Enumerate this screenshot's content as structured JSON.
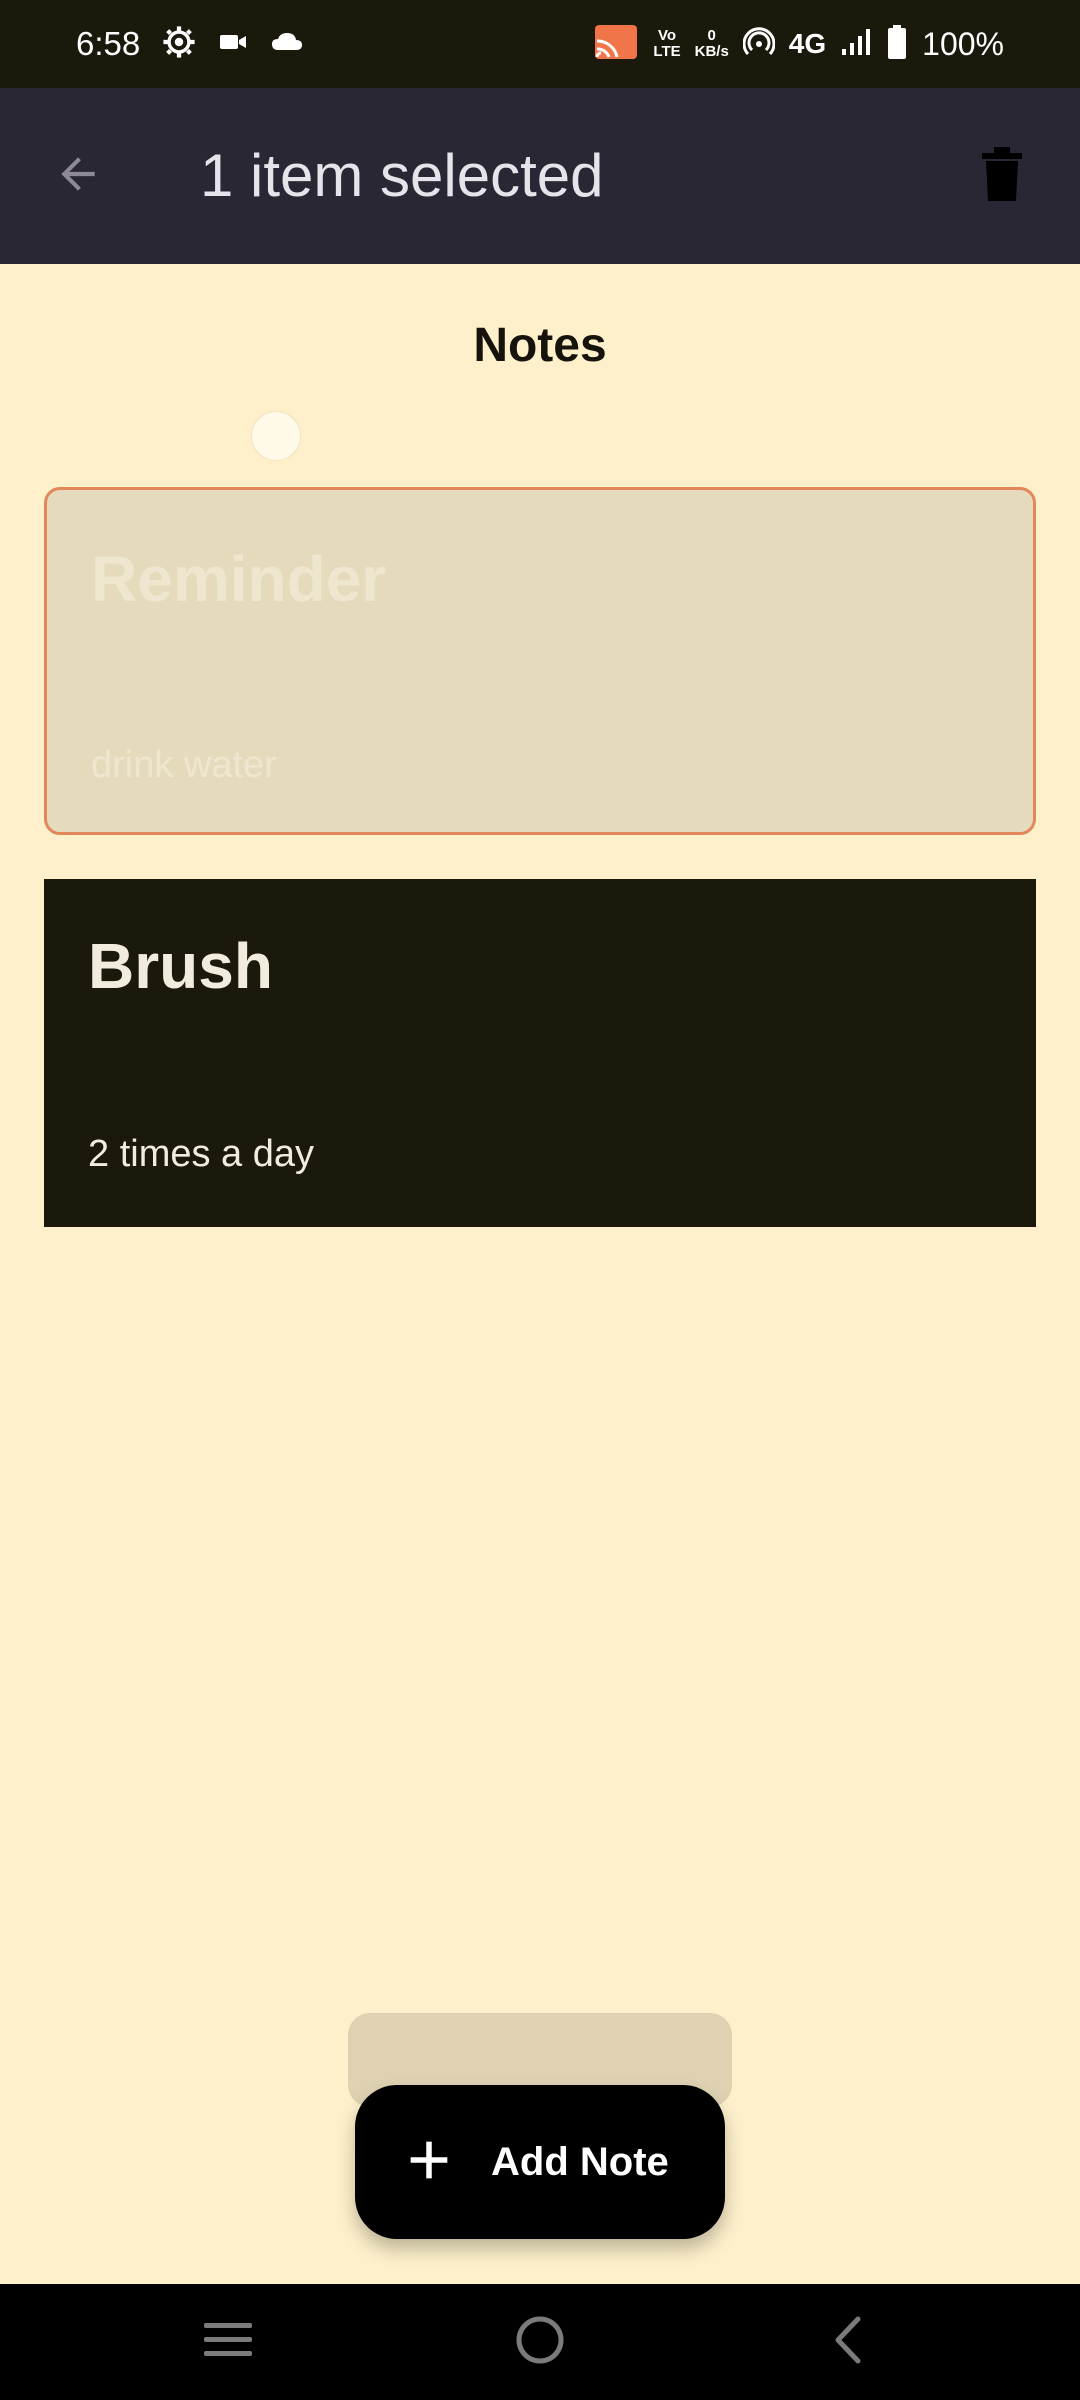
{
  "status_bar": {
    "time": "6:58",
    "volte_top": "Vo",
    "volte_bottom": "LTE",
    "speed_value": "0",
    "speed_unit": "KB/s",
    "network": "4G",
    "battery": "100%",
    "icons": [
      "settings-icon",
      "video-icon",
      "cloud-icon",
      "cast-icon",
      "hotspot-icon",
      "signal-icon",
      "battery-icon"
    ]
  },
  "app_bar": {
    "title": "1 item selected",
    "back_icon": "arrow-back-icon",
    "delete_icon": "trash-icon"
  },
  "page": {
    "title": "Notes"
  },
  "notes": [
    {
      "title": "Reminder",
      "body": "drink water",
      "selected": true
    },
    {
      "title": "Brush",
      "body": "2 times a day",
      "selected": false
    }
  ],
  "fab": {
    "icon": "plus-icon",
    "label": "Add Note"
  },
  "nav_bar": {
    "icons": [
      "menu-icon",
      "home-icon",
      "back-icon"
    ]
  },
  "colors": {
    "background": "#fdf0cb",
    "app_bar": "#292733",
    "selected_card": "#e6dabd",
    "selected_border": "#e3875b",
    "dark_card": "#1b180c",
    "fab": "#000000"
  }
}
